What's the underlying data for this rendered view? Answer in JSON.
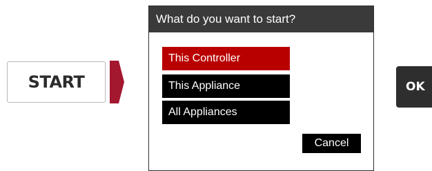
{
  "start": {
    "label": "START",
    "arrow_color": "#a3172f"
  },
  "dialog": {
    "title": "What do you want to start?",
    "options": [
      {
        "label": "This Controller",
        "selected": true
      },
      {
        "label": "This Appliance",
        "selected": false
      },
      {
        "label": "All Appliances",
        "selected": false
      }
    ],
    "cancel_label": "Cancel",
    "selected_color": "#b90000"
  },
  "ok": {
    "label": "OK"
  }
}
